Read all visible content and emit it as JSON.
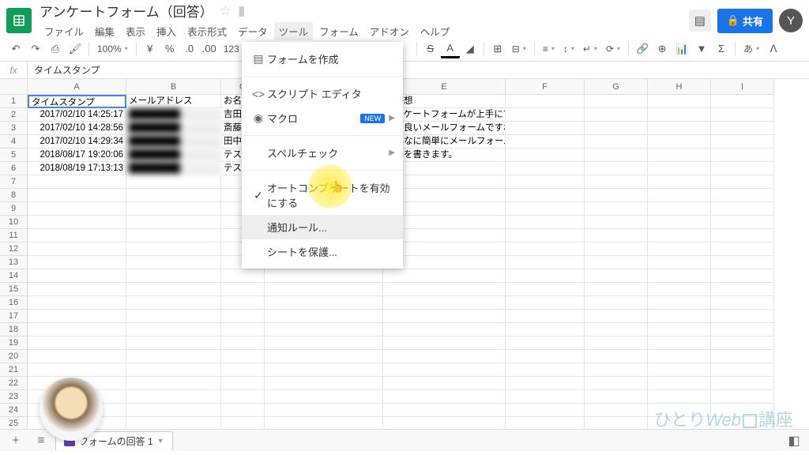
{
  "doc_title": "アンケートフォーム（回答）",
  "menubar": [
    "ファイル",
    "編集",
    "表示",
    "挿入",
    "表示形式",
    "データ",
    "ツール",
    "フォーム",
    "アドオン",
    "ヘルプ"
  ],
  "share_label": "共有",
  "avatar_letter": "Y",
  "zoom": "100%",
  "decimals": "123",
  "formula_value": "タイムスタンプ",
  "columns": [
    "A",
    "B",
    "C",
    "D",
    "E",
    "F",
    "G",
    "H",
    "I"
  ],
  "headers": {
    "A": "タイムスタンプ",
    "B": "メールアドレス",
    "C": "お名前",
    "E": "ご感想"
  },
  "rows": [
    {
      "ts": "2017/02/10 14:25:17",
      "name": "吉田",
      "feedback": "アンケートフォームが上手にできました！"
    },
    {
      "ts": "2017/02/10 14:28:56",
      "name": "斎藤",
      "feedback": "凄く良いメールフォームですね＾＾"
    },
    {
      "ts": "2017/02/10 14:29:34",
      "name": "田中",
      "feedback": "こんなに簡単にメールフォームができるんですね！"
    },
    {
      "ts": "2018/08/17 19:20:06",
      "name": "テス",
      "feedback": "感想を書きます。"
    },
    {
      "ts": "2018/08/19 17:13:13",
      "name": "テス",
      "feedback": "感想"
    }
  ],
  "tools_menu": {
    "create_form": "フォームを作成",
    "script_editor": "スクリプト エディタ",
    "macro": "マクロ",
    "new_badge": "NEW",
    "spellcheck": "スペルチェック",
    "autocomplete": "オートコンプリートを有効にする",
    "notification_rules": "通知ルール...",
    "protect_sheet": "シートを保護..."
  },
  "sheet_tab": "フォームの回答 1",
  "watermark": "ひとりWeb□講座"
}
